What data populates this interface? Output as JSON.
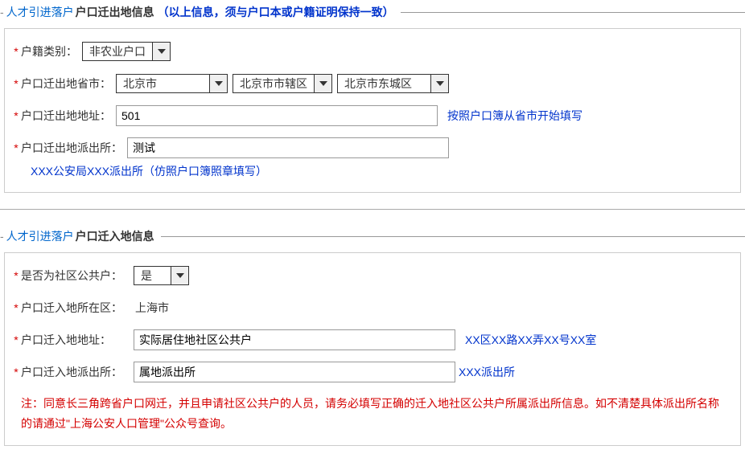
{
  "section1": {
    "titleMain": "人才引进落户",
    "titleSub": "户口迁出地信息",
    "titleNote": "（以上信息，须与户口本或户籍证明保持一致）",
    "hukouType": {
      "label": "户籍类别：",
      "value": "非农业户口"
    },
    "outProvince": {
      "label": "户口迁出地省市：",
      "province": "北京市",
      "city": "北京市市辖区",
      "district": "北京市东城区"
    },
    "outAddress": {
      "label": "户口迁出地地址：",
      "value": "501",
      "hint": "按照户口簿从省市开始填写"
    },
    "outPolice": {
      "label": "户口迁出地派出所：",
      "value": "测试",
      "subHint": "XXX公安局XXX派出所（仿照户口簿照章填写）"
    }
  },
  "section2": {
    "titleMain": "人才引进落户",
    "titleSub": "户口迁入地信息",
    "community": {
      "label": "是否为社区公共户：",
      "value": "是"
    },
    "inRegion": {
      "label": "户口迁入地所在区：",
      "value": "上海市"
    },
    "inAddress": {
      "label": "户口迁入地地址：",
      "value": "实际居住地社区公共户",
      "hint": "XX区XX路XX弄XX号XX室"
    },
    "inPolice": {
      "label": "户口迁入地派出所：",
      "value": "属地派出所",
      "hint": "XXX派出所"
    },
    "note": "注：同意长三角跨省户口网迁，并且申请社区公共户的人员，请务必填写正确的迁入地社区公共户所属派出所信息。如不清楚具体派出所名称的请通过\"上海公安人口管理\"公众号查询。"
  }
}
